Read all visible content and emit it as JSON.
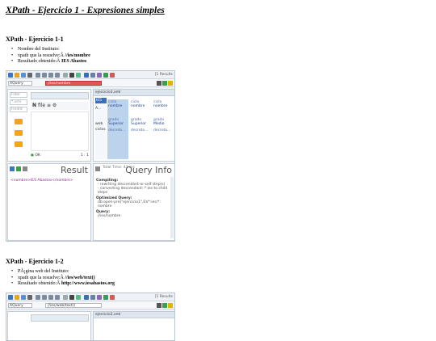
{
  "title": "XPath - Ejercicio 1 - Expresiones simples",
  "sections": [
    {
      "heading": "XPath - Ejercicio 1-1",
      "bullets": [
        {
          "text": "Nombre del Instituto:",
          "value": ""
        },
        {
          "text": "xpath que la resuelve:Â  ",
          "value": "//ies/nombre"
        },
        {
          "text": "Resultado obtenido:Â  ",
          "value": "IES Abastos"
        }
      ]
    },
    {
      "heading": "XPath - Ejercicio 1-2",
      "bullets": [
        {
          "text": "PÃ¡gina web del Instituto:",
          "value": ""
        },
        {
          "text": "xpath que la resuelve:Â  ",
          "value": "//ies/web/text()"
        },
        {
          "text": "Resultado obtenido:Â  ",
          "value": "http://www.iesabastos.org"
        }
      ]
    }
  ],
  "shot1": {
    "results_label": "[1 Results",
    "language": "XQuery",
    "query": "//ies/nombre",
    "filter_placeholder": "Filter",
    "filter2": "Findnt",
    "file_tab": "ejercicio1.xml",
    "grid": [
      {
        "k": "ciclo",
        "v": "nombre",
        "sub": "grado",
        "type": "Superior",
        "desc": "decreto..."
      },
      {
        "k": "ciclo",
        "v": "nombre",
        "sub": "grado",
        "type": "Superior",
        "desc": "decreto..."
      },
      {
        "k": "ciclo",
        "v": "nombre",
        "sub": "grado",
        "type": "Medio",
        "desc": "decreto..."
      }
    ],
    "left_labels": [
      "IES",
      "A...",
      "web",
      "ciclos"
    ],
    "status": "OK",
    "pos": "1 : 1",
    "result_title": "Result",
    "result_text": "<nombre>IES Abastos</nombre>",
    "timing": "Total Time: 43 ms",
    "info_title": "Query Info",
    "compiling": "Compiling:",
    "compiling_lines": [
      "- rewriting descendant-or-self step(s)",
      "- converting descendant::*:ies to child",
      "steps"
    ],
    "optimized": "Optimized Query:",
    "optimized_lines": [
      "db:open-pre(\"ejercicio1\",0)/*:ies/*:",
      "nombre"
    ],
    "query_label": "Query:",
    "query_line": "//ies/nombre"
  },
  "shot2": {
    "results_label": "[1 Results",
    "language": "XQuery",
    "query": "//ies/web/text()",
    "file_tab": "ejercicio1.xml"
  }
}
